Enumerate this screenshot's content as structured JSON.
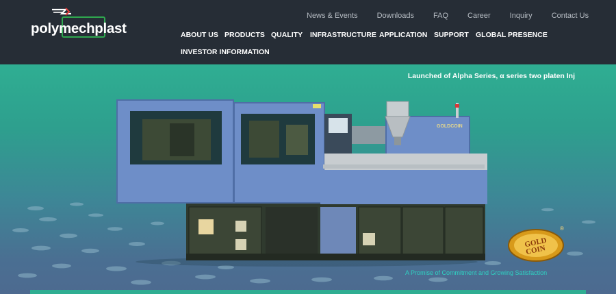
{
  "brand": {
    "name": "polymechplast",
    "accent_color": "#2fa84f"
  },
  "util_nav": {
    "items": [
      {
        "label": "News & Events"
      },
      {
        "label": "Downloads"
      },
      {
        "label": "FAQ"
      },
      {
        "label": "Career"
      },
      {
        "label": "Inquiry"
      },
      {
        "label": "Contact Us"
      }
    ]
  },
  "main_nav": {
    "items": [
      {
        "label": "ABOUT US"
      },
      {
        "label": "PRODUCTS"
      },
      {
        "label": "QUALITY"
      },
      {
        "label": "INFRASTRUCTURE"
      },
      {
        "label": "APPLICATION"
      },
      {
        "label": "SUPPORT"
      },
      {
        "label": "GLOBAL PRESENCE"
      },
      {
        "label": "INVESTOR INFORMATION"
      }
    ]
  },
  "hero": {
    "caption": "Launched of Alpha Series, α series two platen Inj",
    "machine_brand": "GOLDCOIN",
    "badge_text": "GOLD COIN",
    "tagline": "A Promise of Commitment and Growing Satisfaction",
    "colors": {
      "header_bg": "#262d36",
      "hero_top": "#2fae92",
      "hero_bottom": "#4d6a90"
    }
  }
}
